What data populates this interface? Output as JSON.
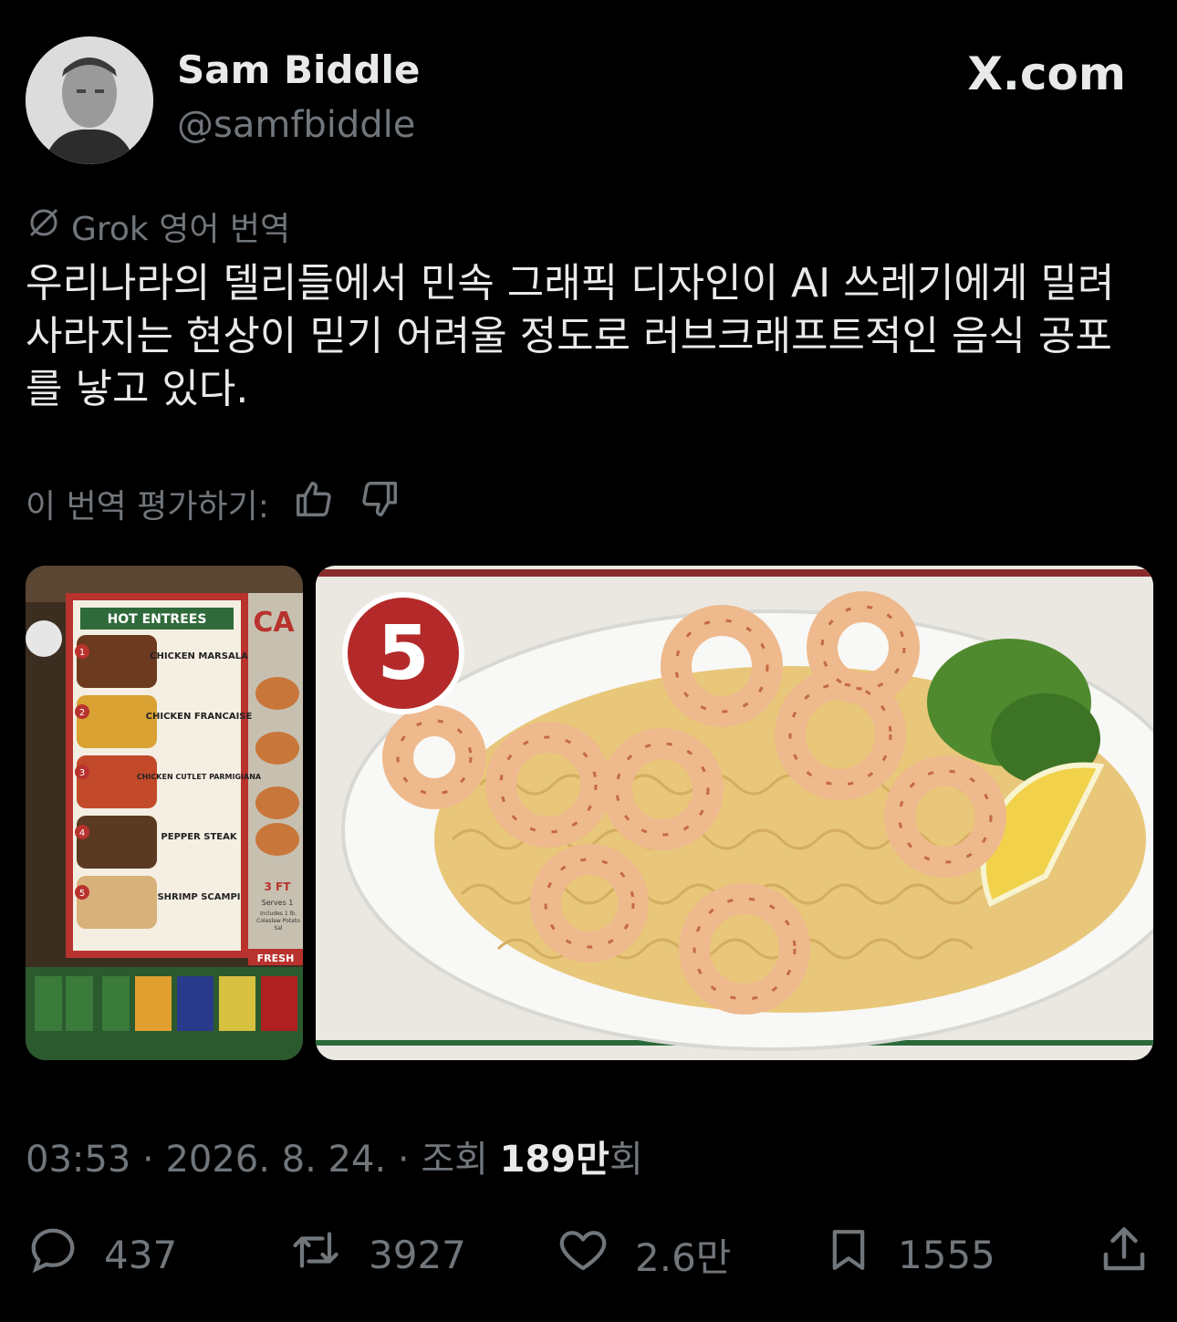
{
  "author": {
    "name": "Sam Biddle",
    "handle": "@samfbiddle"
  },
  "brand": "X.com",
  "translation": {
    "label": "Grok 영어 번역",
    "text": "우리나라의 델리들에서 민속 그래픽 디자인이 AI 쓰레기에게 밀려 사라지는 현상이 믿기 어려울 정도로 러브크래프트적인 음식 공포를 낳고 있다.",
    "rate_label": "이 번역 평가하기:"
  },
  "menu_board": {
    "header": "HOT ENTREES",
    "items": [
      {
        "num": "1",
        "name": "CHICKEN MARSALA"
      },
      {
        "num": "2",
        "name": "CHICKEN FRANCAISE"
      },
      {
        "num": "3",
        "name": "CHICKEN CUTLET PARMIGIANA"
      },
      {
        "num": "4",
        "name": "PEPPER STEAK"
      },
      {
        "num": "5",
        "name": "SHRIMP SCAMPI"
      }
    ],
    "side_text": "3 FT",
    "side_sub": "Serves 1",
    "side_includes": "Includes 1 lb. Coleslaw Potato Sal",
    "fresh": "FRESH",
    "corner": "CA"
  },
  "closeup": {
    "badge": "5"
  },
  "meta": {
    "time": "03:53",
    "date": "2026. 8. 24.",
    "views_prefix": "조회",
    "views_value": "189만",
    "views_suffix": "회"
  },
  "actions": {
    "replies": "437",
    "reposts": "3927",
    "likes": "2.6만",
    "bookmarks": "1555"
  }
}
